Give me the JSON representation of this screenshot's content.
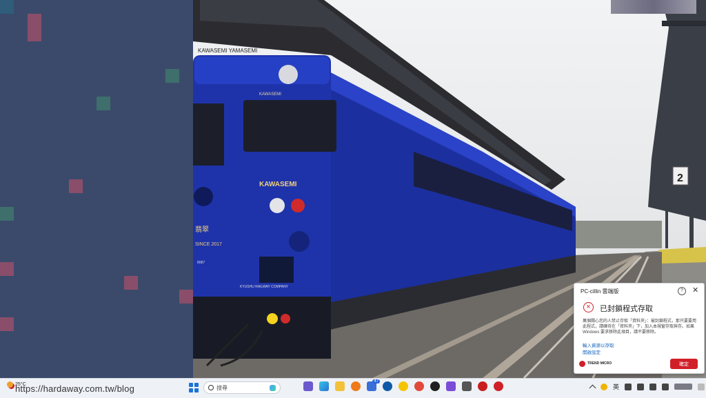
{
  "desktop": {
    "watermark": "https://hardaway.com.tw/blog",
    "train_front_texts": {
      "header": "KAWASEMI YAMASEMI",
      "name": "KAWASEMI",
      "side_name": "KAWASEMI",
      "since": "SINCE 2017",
      "kanji": "翡翠",
      "number": "8087",
      "company": "KYUSHU RAILWAY COMPANY"
    },
    "platform_number": "2"
  },
  "taskbar": {
    "weather_temp": "25°C",
    "search_placeholder": "搜尋",
    "badge_count": "47",
    "ime_label": "英"
  },
  "dialog": {
    "title": "PC-cillin 雲端版",
    "help": "?",
    "close": "✕",
    "heading": "已封鎖程式存取",
    "body": "萬個關心您的人禁止存取「資料夾」：被封鎖程式，那只要要用此程式，請確待在「資料夾」下，加入本視窗存取與存。如果 Windows 要求移除此項目，請不要移除。",
    "link_add": "輸入資源以存取",
    "link_settings": "開啟設定",
    "brand": "TREND MICRO",
    "ok_label": "確定"
  },
  "colors": {
    "train_blue": "#1b2f9e",
    "dialog_red": "#d11f2a",
    "link_blue": "#1565c0"
  }
}
